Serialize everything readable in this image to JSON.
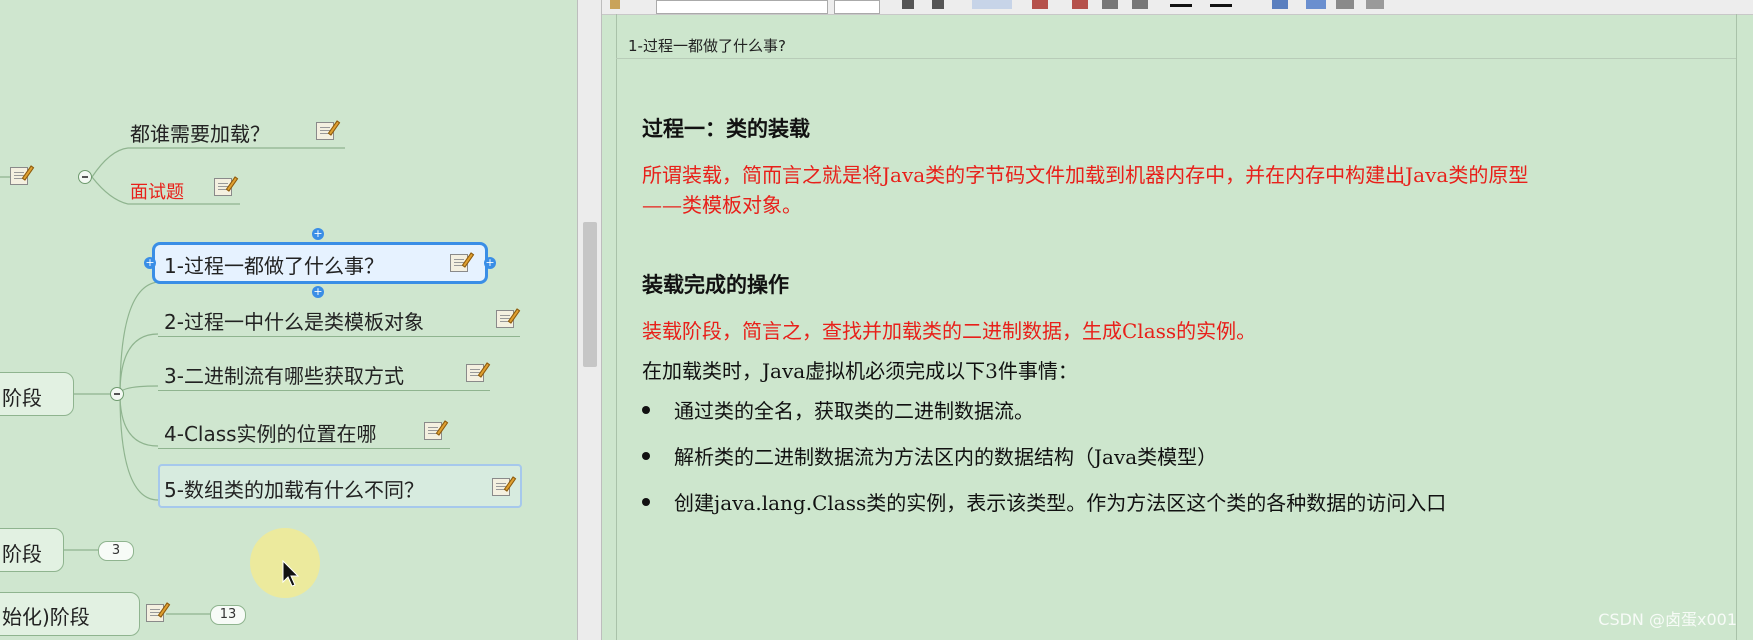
{
  "mindmap": {
    "sibling_nodes": [
      {
        "label": "都谁需要加载？"
      },
      {
        "label": "面试题"
      }
    ],
    "children": [
      {
        "label": "1-过程一都做了什么事？",
        "selected": true
      },
      {
        "label": "2-过程一中什么是类模板对象"
      },
      {
        "label": "3-二进制流有哪些获取方式"
      },
      {
        "label": "4-Class实例的位置在哪"
      },
      {
        "label": "5-数组类的加载有什么不同？"
      }
    ],
    "parents": [
      {
        "label": "阶段"
      },
      {
        "label": "阶段",
        "count": "3"
      },
      {
        "label": "始化)阶段",
        "count": "13"
      }
    ]
  },
  "note": {
    "title": "1-过程一都做了什么事?",
    "section1_heading": "过程一：类的装载",
    "section1_line1": "所谓装载，简而言之就是将Java类的字节码文件加载到机器内存中，并在内存中构建出Java类的原型",
    "section1_line2": "——类模板对象。",
    "section2_heading": "装载完成的操作",
    "section2_red": "装载阶段，简言之，查找并加载类的二进制数据，生成Class的实例。",
    "section2_intro": "在加载类时，Java虚拟机必须完成以下3件事情：",
    "bullets": [
      "通过类的全名，获取类的二进制数据流。",
      "解析类的二进制数据流为方法区内的数据结构（Java类模型）",
      "创建java.lang.Class类的实例，表示该类型。作为方法区这个类的各种数据的访问入口"
    ]
  },
  "watermark": "CSDN @卤蛋x001",
  "colors": {
    "background": "#cfe6cf",
    "red_text": "#e8201a",
    "red_node": "#e8201a",
    "selection": "#3a8ee6"
  }
}
